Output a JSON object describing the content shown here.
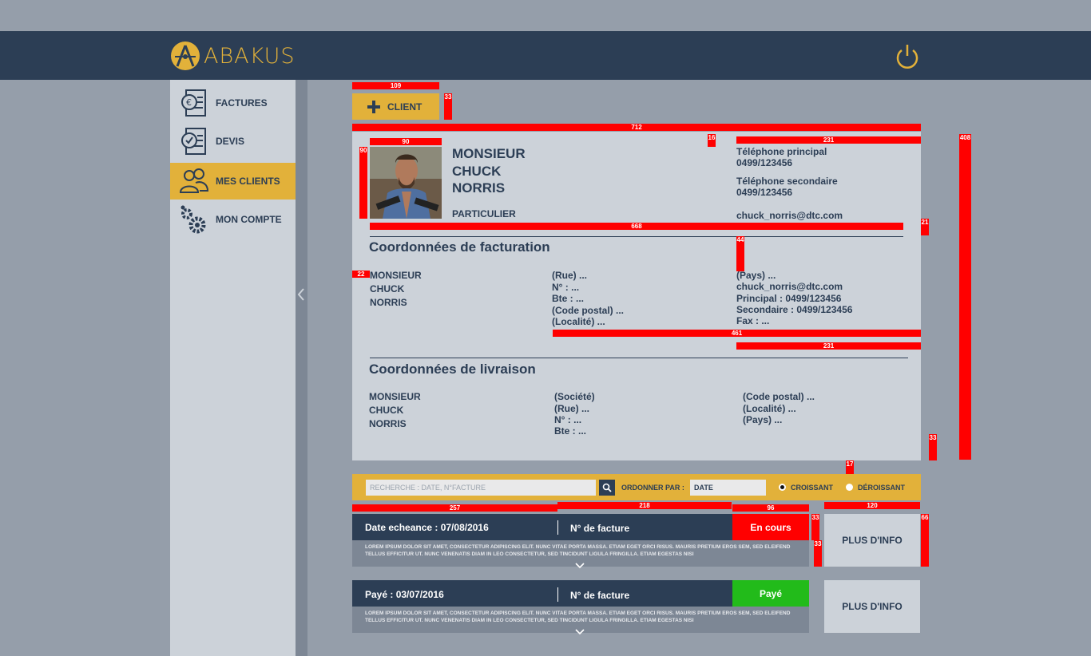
{
  "app": {
    "name": "ABAKUS"
  },
  "header": {
    "power_icon": "power-icon"
  },
  "sidebar": {
    "items": [
      {
        "label": "FACTURES",
        "icon": "invoice-euro-icon"
      },
      {
        "label": "DEVIS",
        "icon": "quote-check-icon"
      },
      {
        "label": "MES CLIENTS",
        "icon": "users-icon",
        "active": true
      },
      {
        "label": "MON COMPTE",
        "icon": "gears-icon"
      }
    ]
  },
  "toolbar": {
    "add_client_label": "CLIENT"
  },
  "client": {
    "title": "MONSIEUR",
    "first_name": "CHUCK",
    "last_name": "NORRIS",
    "type": "PARTICULIER",
    "phone_primary_label": "Téléphone principal",
    "phone_primary": "0499/123456",
    "phone_secondary_label": "Téléphone secondaire",
    "phone_secondary": "0499/123456",
    "email": "chuck_norris@dtc.com"
  },
  "billing": {
    "heading": "Coordonnées de facturation",
    "name": [
      "MONSIEUR",
      "CHUCK",
      "NORRIS"
    ],
    "address": [
      "(Rue) ...",
      "N° : ...",
      "Bte : ...",
      "(Code postal) ...",
      "(Localité) ..."
    ],
    "contact": [
      "(Pays) ...",
      "chuck_norris@dtc.com",
      "Principal : 0499/123456",
      "Secondaire : 0499/123456",
      "Fax : ..."
    ]
  },
  "delivery": {
    "heading": "Coordonnées de livraison",
    "name": [
      "MONSIEUR",
      "CHUCK",
      "NORRIS"
    ],
    "address": [
      "(Société)",
      "(Rue) ...",
      "N° : ...",
      "Bte : ..."
    ],
    "extra": [
      "(Code postal) ...",
      "(Localité) ...",
      "(Pays) ..."
    ]
  },
  "filter": {
    "search_placeholder": "RECHERCHE : DATE, N°FACTURE",
    "order_label": "ORDONNER PAR :",
    "order_value": "DATE",
    "asc_label": "CROISSANT",
    "desc_label": "DÉROISSANT",
    "selected": "asc"
  },
  "invoices": [
    {
      "date_label": "Date echeance : 07/08/2016",
      "number_label": "N° de facture",
      "status": "En cours",
      "status_color": "#ff0000",
      "more_label": "PLUS D'INFO",
      "lorem": "LOREM IPSUM DOLOR SIT AMET, CONSECTETUR ADIPISCING ELIT. NUNC VITAE PORTA MASSA. ETIAM EGET ORCI RISUS. MAURIS PRETIUM EROS SEM, SED ELEIFEND TELLUS EFFICITUR UT. NUNC VENENATIS DIAM IN LEO CONSECTETUR, SED TINCIDUNT LIGULA FRINGILLA. ETIAM EGESTAS NISI"
    },
    {
      "date_label": "Payé : 03/07/2016",
      "number_label": "N° de facture",
      "status": "Payé",
      "status_color": "#22bb1a",
      "more_label": "PLUS D'INFO",
      "lorem": "LOREM IPSUM DOLOR SIT AMET, CONSECTETUR ADIPISCING ELIT. NUNC VITAE PORTA MASSA. ETIAM EGET ORCI RISUS. MAURIS PRETIUM EROS SEM, SED ELEIFEND TELLUS EFFICITUR UT. NUNC VENENATIS DIAM IN LEO CONSECTETUR, SED TINCIDUNT LIGULA FRINGILLA. ETIAM EGESTAS NISI"
    }
  ],
  "dimension_annotations": {
    "btn_width": "109",
    "btn_height": "33",
    "card_width": "712",
    "photo_width": "90",
    "photo_height": "90",
    "gap_16": "16",
    "col_231": "231",
    "card_height": "408",
    "row_668": "668",
    "gap_21": "21",
    "gap_44": "44",
    "margin_22": "22",
    "span_461": "461",
    "col_231b": "231",
    "gap_33": "33",
    "gap_17": "17",
    "col_257": "257",
    "col_218": "218",
    "col_96": "96",
    "col_120": "120",
    "gap_33b": "33",
    "gap_33c": "33",
    "h_66": "66"
  },
  "colors": {
    "navy": "#2c3e55",
    "gold": "#e2b13a",
    "bg": "#959eaa",
    "panel": "#ccd2d9"
  }
}
